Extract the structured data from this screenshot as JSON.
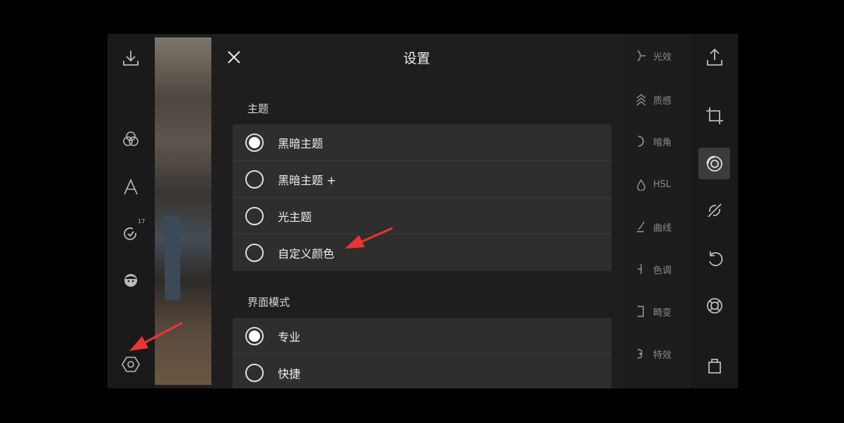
{
  "settings": {
    "title": "设置",
    "theme_section": {
      "label": "主题",
      "options": [
        {
          "label": "黑暗主题",
          "selected": true
        },
        {
          "label": "黑暗主题 +",
          "selected": false
        },
        {
          "label": "光主题",
          "selected": false
        },
        {
          "label": "自定义颜色",
          "selected": false
        }
      ]
    },
    "mode_section": {
      "label": "界面模式",
      "options": [
        {
          "label": "专业",
          "selected": true
        },
        {
          "label": "快捷",
          "selected": false
        }
      ]
    }
  },
  "left_toolbar": {
    "icons": [
      "download-icon",
      "filters-icon",
      "text-icon",
      "history-icon",
      "face-icon",
      "settings-icon"
    ],
    "history_badge": "17"
  },
  "right_toolbar": {
    "icons": [
      "share-icon",
      "crop-icon",
      "adjust-icon",
      "heal-icon",
      "undo-icon",
      "lens-icon",
      "bag-icon"
    ]
  },
  "tool_labels": [
    "光效",
    "质感",
    "暗角",
    "HSL",
    "曲线",
    "色调",
    "畸变",
    "特效"
  ],
  "colors": {
    "background": "#000000",
    "panel": "#1e1e1e",
    "option_row": "#2e2e2e",
    "annotation_arrow": "#ee3333"
  }
}
